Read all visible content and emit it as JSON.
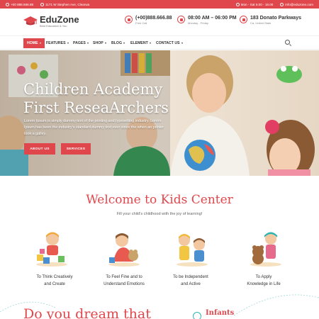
{
  "topbar": {
    "phone": "+00 888.666.88",
    "address": "1171 W Stephen Ave, Clearwa",
    "hours": "Mon - Sat 8.00 - 18.00",
    "email": "info@eduzone.com"
  },
  "brand": {
    "name": "EduZone",
    "tagline": "Best Education & You",
    "accent": "#e0474c",
    "teal": "#2ab5b0"
  },
  "contacts": [
    {
      "icon": "phone-icon",
      "big": "(+00)888.666.88",
      "small": "Free Call"
    },
    {
      "icon": "clock-icon",
      "big": "08:00 AM – 06:00 PM",
      "small": "Monday - Friday"
    },
    {
      "icon": "map-icon",
      "big": "183 Donato Parkways",
      "small": "Ca, United State"
    }
  ],
  "nav": [
    {
      "label": "HOME",
      "has_caret": true
    },
    {
      "label": "FEATURES",
      "has_caret": true
    },
    {
      "label": "PAGES",
      "has_caret": true
    },
    {
      "label": "SHOP",
      "has_caret": true
    },
    {
      "label": "BLOG",
      "has_caret": true
    },
    {
      "label": "ELEMENT",
      "has_caret": true
    },
    {
      "label": "CONTACT US",
      "has_caret": true
    }
  ],
  "hero": {
    "title_line1": "Children Academy",
    "title_line2": "First ReseaArchers",
    "text": "Lorem Ipsum is simply dummy text of the printing and typesetting industry. Lorem Ipsum has been the industry's standard dummy text ever since the when an printer took a galley.",
    "button_about": "ABOUT US",
    "button_services": "SERVICES"
  },
  "welcome": {
    "title": "Welcome to Kids Center",
    "subtitle": "Fill your child's childhood with the joy of learning!"
  },
  "features": [
    {
      "line1": "To Think Creatively",
      "line2": "and Create"
    },
    {
      "line1": "To Feel Fine and to",
      "line2": "Understand Emotions"
    },
    {
      "line1": "To be Independent",
      "line2": "and Active"
    },
    {
      "line1": "To Apply",
      "line2": "Knowledge in Life"
    }
  ],
  "bottom": {
    "heading": "Do you dream that",
    "side_item": "Infants"
  }
}
